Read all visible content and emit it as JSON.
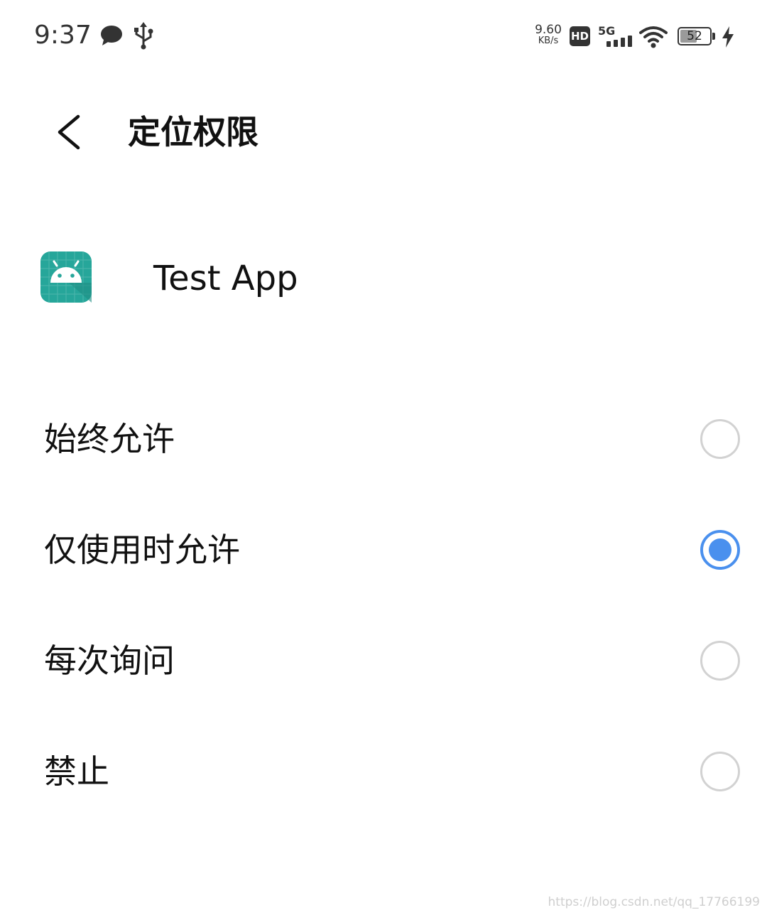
{
  "status_bar": {
    "time": "9:37",
    "net_speed_value": "9.60",
    "net_speed_unit": "KB/s",
    "hd_label": "HD",
    "network_type": "5G",
    "battery_level": "52",
    "icons": [
      "chat-bubble-icon",
      "usb-icon",
      "hd-icon",
      "signal-icon",
      "wifi-icon",
      "battery-icon",
      "charging-bolt-icon"
    ]
  },
  "title_bar": {
    "title": "定位权限",
    "back_icon": "chevron-left-icon"
  },
  "app": {
    "name": "Test App",
    "icon": "android-robot-icon",
    "icon_color": "#26A69A"
  },
  "options": [
    {
      "label": "始终允许",
      "selected": false
    },
    {
      "label": "仅使用时允许",
      "selected": true
    },
    {
      "label": "每次询问",
      "selected": false
    },
    {
      "label": "禁止",
      "selected": false
    }
  ],
  "colors": {
    "accent": "#4A90EE",
    "radio_unselected": "#D2D2D2"
  },
  "watermark": "https://blog.csdn.net/qq_17766199"
}
